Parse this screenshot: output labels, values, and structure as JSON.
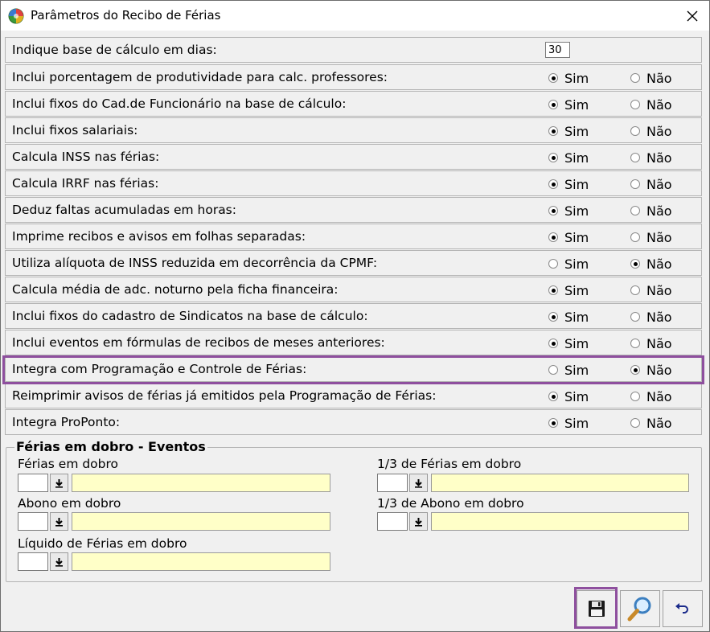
{
  "window": {
    "title": "Parâmetros do Recibo de Férias"
  },
  "options": {
    "sim": "Sim",
    "nao": "Não"
  },
  "params": [
    {
      "label": "Indique base de cálculo em dias:",
      "type": "number",
      "value": "30"
    },
    {
      "label": "Inclui porcentagem de produtividade para calc. professores:",
      "type": "radio",
      "selected": "sim"
    },
    {
      "label": "Inclui fixos do Cad.de Funcionário na base de cálculo:",
      "type": "radio",
      "selected": "sim"
    },
    {
      "label": "Inclui fixos salariais:",
      "type": "radio",
      "selected": "sim"
    },
    {
      "label": "Calcula INSS nas férias:",
      "type": "radio",
      "selected": "sim"
    },
    {
      "label": "Calcula IRRF nas férias:",
      "type": "radio",
      "selected": "sim"
    },
    {
      "label": "Deduz faltas acumuladas em horas:",
      "type": "radio",
      "selected": "sim"
    },
    {
      "label": "Imprime recibos e avisos em folhas separadas:",
      "type": "radio",
      "selected": "sim"
    },
    {
      "label": "Utiliza alíquota de INSS reduzida em decorrência da CPMF:",
      "type": "radio",
      "selected": "nao"
    },
    {
      "label": "Calcula média de adc. noturno pela ficha financeira:",
      "type": "radio",
      "selected": "sim"
    },
    {
      "label": "Inclui fixos do cadastro de Sindicatos na base de cálculo:",
      "type": "radio",
      "selected": "sim"
    },
    {
      "label": "Inclui eventos em fórmulas de recibos de meses anteriores:",
      "type": "radio",
      "selected": "sim"
    },
    {
      "label": "Integra com Programação e Controle de Férias:",
      "type": "radio",
      "selected": "nao"
    },
    {
      "label": "Reimprimir avisos de férias já emitidos pela Programação de Férias:",
      "type": "radio",
      "selected": "sim"
    },
    {
      "label": "Integra ProPonto:",
      "type": "radio",
      "selected": "sim"
    }
  ],
  "events_group": {
    "title": "Férias em dobro - Eventos",
    "fields": [
      {
        "label": "Férias em dobro",
        "code": "",
        "description": ""
      },
      {
        "label": "1/3 de Férias em dobro",
        "code": "",
        "description": ""
      },
      {
        "label": "Abono em dobro",
        "code": "",
        "description": ""
      },
      {
        "label": "1/3 de Abono em dobro",
        "code": "",
        "description": ""
      },
      {
        "label": "Líquido de Férias em dobro",
        "code": "",
        "description": ""
      }
    ]
  },
  "toolbar": {
    "buttons": [
      {
        "name": "save-button",
        "icon": "floppy-disk-icon"
      },
      {
        "name": "search-button",
        "icon": "magnifier-icon"
      },
      {
        "name": "undo-button",
        "icon": "undo-arrow-icon"
      }
    ]
  },
  "colors": {
    "highlight": "#8e4f9e",
    "lookup_field_bg": "#ffffc8"
  }
}
